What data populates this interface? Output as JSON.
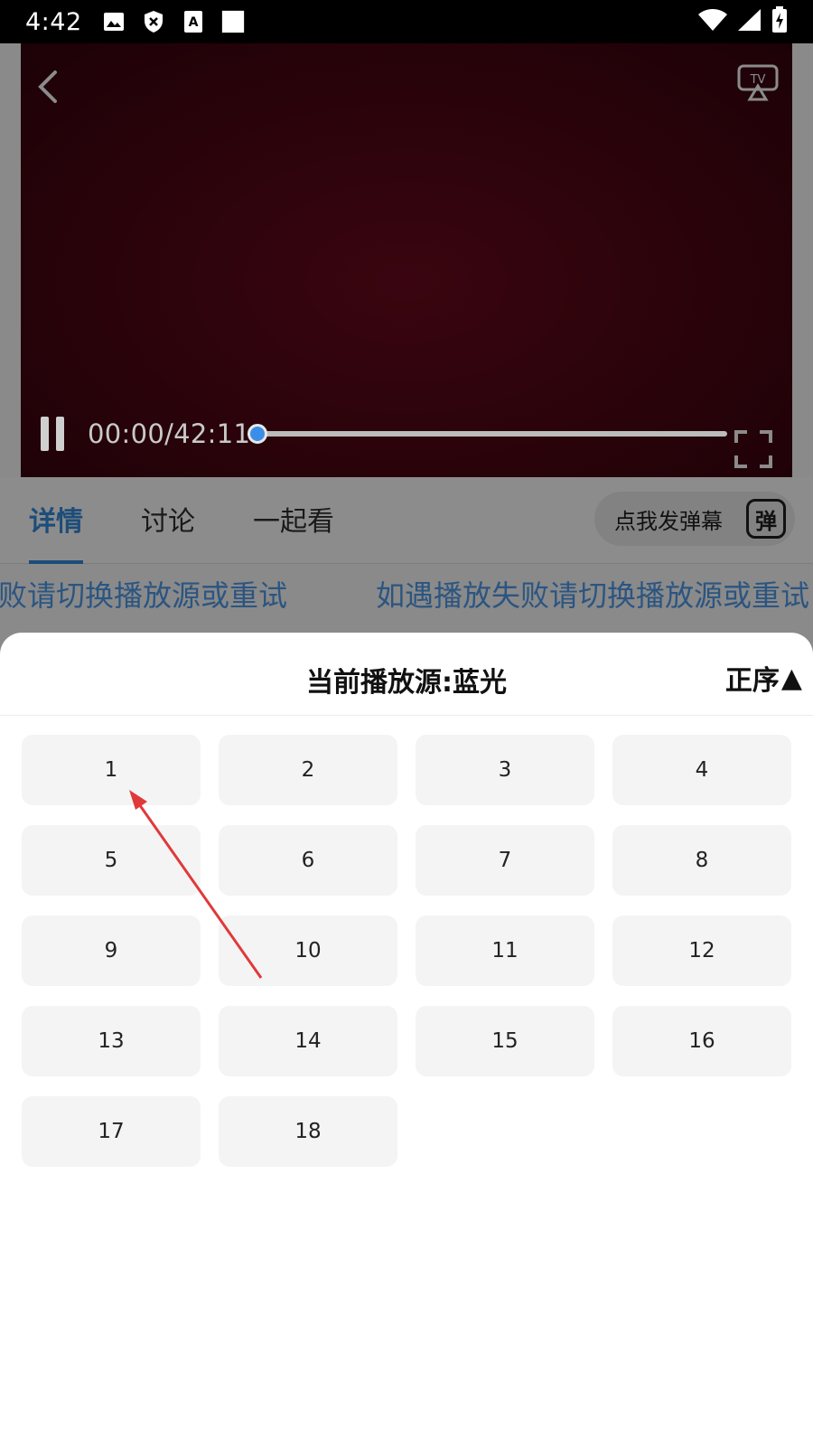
{
  "status_bar": {
    "time": "4:42",
    "left_icons": [
      "image-icon",
      "shield-icon",
      "font-icon",
      "square-icon"
    ],
    "right_icons": [
      "wifi-icon",
      "signal-icon",
      "battery-charging-icon"
    ]
  },
  "player": {
    "time_readout": "00:00/42:11",
    "progress_fraction": 0.0,
    "background_color": "#2a030a",
    "accent_color": "#3b8ee8"
  },
  "tabs": {
    "items": [
      {
        "label": "详情",
        "active": true
      },
      {
        "label": "讨论",
        "active": false
      },
      {
        "label": "一起看",
        "active": false
      }
    ],
    "danmaku_placeholder": "点我发弹幕",
    "danmaku_icon_label": "弹"
  },
  "notice": {
    "text_left": "败请切换播放源或重试",
    "text_right": "如遇播放失败请切换播放源或重试"
  },
  "sheet": {
    "title": "当前播放源:蓝光",
    "sort_label": "正序",
    "sort_arrow": "▲",
    "episodes": [
      "1",
      "2",
      "3",
      "4",
      "5",
      "6",
      "7",
      "8",
      "9",
      "10",
      "11",
      "12",
      "13",
      "14",
      "15",
      "16",
      "17",
      "18"
    ]
  },
  "annotation": {
    "color": "#e0393a",
    "points_to": "1"
  }
}
